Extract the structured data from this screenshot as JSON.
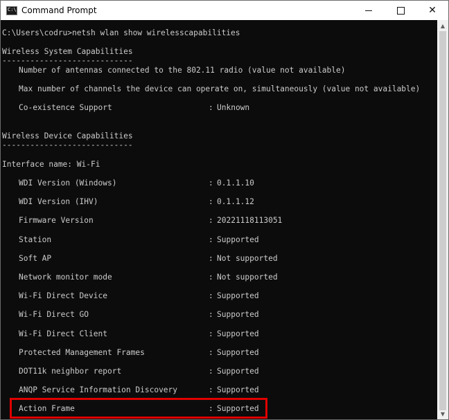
{
  "window": {
    "title": "Command Prompt",
    "icon_text": "C:\\",
    "minimize": "minimize",
    "maximize": "maximize",
    "close": "✕"
  },
  "console": {
    "prompt": "C:\\Users\\codru>netsh wlan show wirelesscapabilities",
    "system_header": "Wireless System Capabilities",
    "system_rule": "----------------------------",
    "antennas": "Number of antennas connected to the 802.11 radio (value not available)",
    "channels": "Max number of channels the device can operate on, simultaneously (value not available)",
    "coexist_key": "Co-existence Support",
    "coexist_val": "Unknown",
    "device_header": "Wireless Device Capabilities",
    "device_rule": "----------------------------",
    "interface": "Interface name: Wi-Fi",
    "capabilities": [
      {
        "key": "WDI Version (Windows)",
        "value": "0.1.1.10"
      },
      {
        "key": "WDI Version (IHV)",
        "value": "0.1.1.12"
      },
      {
        "key": "Firmware Version",
        "value": "20221118113051"
      },
      {
        "key": "Station",
        "value": "Supported"
      },
      {
        "key": "Soft AP",
        "value": "Not supported"
      },
      {
        "key": "Network monitor mode",
        "value": "Not supported"
      },
      {
        "key": "Wi-Fi Direct Device",
        "value": "Supported"
      },
      {
        "key": "Wi-Fi Direct GO",
        "value": "Supported"
      },
      {
        "key": "Wi-Fi Direct Client",
        "value": "Supported"
      },
      {
        "key": "Protected Management Frames",
        "value": "Supported"
      },
      {
        "key": "DOT11k neighbor report",
        "value": "Supported"
      },
      {
        "key": "ANQP Service Information Discovery",
        "value": "Supported"
      },
      {
        "key": "Action Frame",
        "value": "Supported"
      }
    ],
    "separator": ":"
  },
  "scrollbar": {
    "up": "▲",
    "down": "▼"
  },
  "colors": {
    "console_bg": "#0c0c0c",
    "console_text": "#cccccc",
    "highlight": "#e00000"
  }
}
